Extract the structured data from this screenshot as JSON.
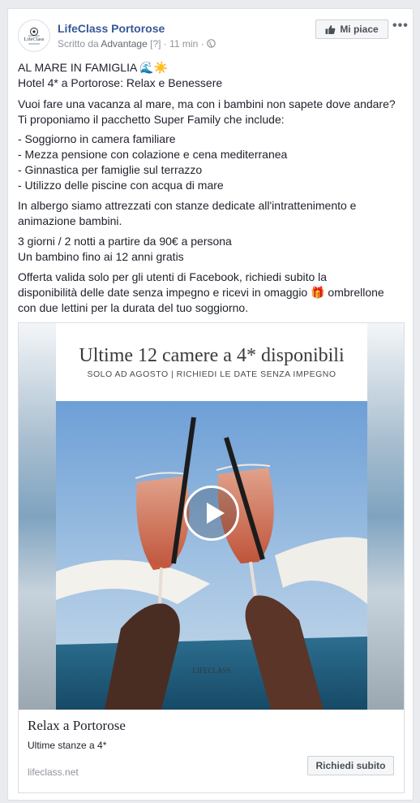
{
  "post": {
    "page_name": "LifeClass Portorose",
    "avatar_text": "LifeClass",
    "meta_prefix": "Scritto da",
    "meta_author": "Advantage",
    "meta_help": "[?]",
    "meta_time": "11 min",
    "like_label": "Mi piace",
    "more_label": "•••"
  },
  "body": {
    "lines": [
      "AL MARE IN FAMIGLIA 🌊☀️",
      "Hotel 4* a Portorose: Relax e Benessere",
      "Vuoi fare una vacanza al mare, ma con i bambini non sapete dove andare?",
      "Ti proponiamo il pacchetto Super Family che include:",
      "- Soggiorno in camera familiare",
      "- Mezza pensione con colazione e cena mediterranea",
      "- Ginnastica per famiglie sul terrazzo",
      "- Utilizzo delle piscine con acqua di mare",
      "In albergo siamo attrezzati con stanze dedicate all'intrattenimento e",
      "animazione bambini.",
      "3 giorni / 2 notti a partire da 90€ a persona",
      "Un bambino fino ai 12 anni gratis",
      "Offerta valida solo per gli utenti di Facebook, richiedi subito la",
      "disponibilità delle date senza impegno e ricevi in omaggio 🎁 ombrellone",
      "con due lettini per la durata del tuo soggiorno."
    ]
  },
  "media": {
    "headline": "Ultime 12 camere a 4* disponibili",
    "subline": "SOLO AD AGOSTO | RICHIEDI LE DATE SENZA IMPEGNO",
    "watermark": "LIFECLASS",
    "play_icon": "play-icon"
  },
  "link": {
    "title": "Relax a Portorose",
    "description": "Ultime stanze a 4*",
    "domain": "lifeclass.net",
    "cta": "Richiedi subito"
  },
  "colors": {
    "link_blue": "#365899",
    "text": "#1d2129",
    "muted": "#90949c",
    "background": "#e9ebee"
  }
}
